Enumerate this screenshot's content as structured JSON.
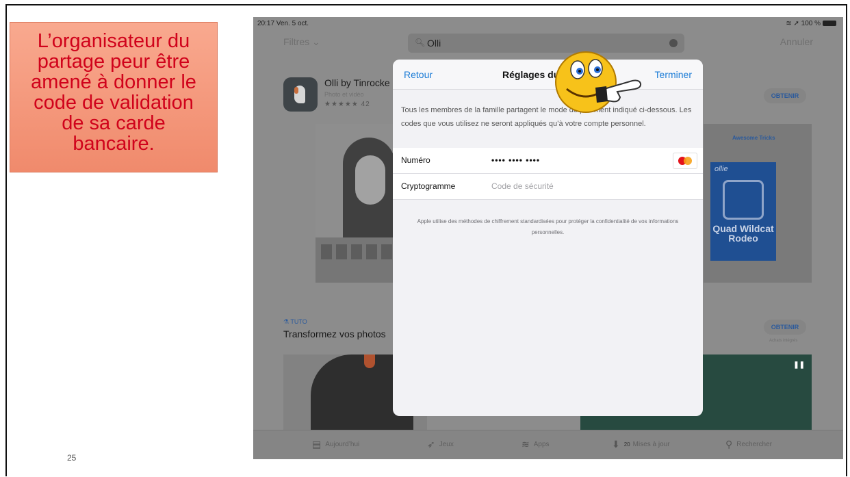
{
  "callout": {
    "lines": [
      "L’organisateur du",
      "partage peur être",
      "amené à donner le",
      "code de validation",
      "de sa carde",
      "bancaire."
    ]
  },
  "slide": {
    "page_number": "25"
  },
  "status_bar": {
    "time": "20:17  Ven. 5 oct.",
    "right": "100 %"
  },
  "top_bar": {
    "filters": "Filtres",
    "search_value": "Olli",
    "cancel": "Annuler"
  },
  "app": {
    "name": "Olli by Tinrocke",
    "category": "Photo et vidéo",
    "rating_count": "42",
    "get_label": "OBTENIR"
  },
  "right_panel": {
    "tag": "Awesome Tricks",
    "poster_logo": "ollie",
    "poster_title": "Quad Wildcat Rodeo"
  },
  "tuto": {
    "label": "TUTO",
    "title": "Transformez vos photos",
    "get_label": "OBTENIR",
    "sub": "Achats intégrés"
  },
  "modal": {
    "back": "Retour",
    "title": "Réglages du",
    "done": "Terminer",
    "info": "Tous les membres de la famille partagent le mode de paiement indiqué ci-dessous. Les codes que vous utilisez ne seront appliqués qu’à votre compte personnel.",
    "number_label": "Numéro",
    "number_value": "•••• •••• ••••",
    "cvv_label": "Cryptogramme",
    "cvv_placeholder": "Code de sécurité",
    "note": "Apple utilise des méthodes de chiffrement standardisées pour protéger la confidentialité de vos informations personnelles."
  },
  "tab_bar": [
    {
      "label": "Aujourd’hui",
      "icon": "today-icon"
    },
    {
      "label": "Jeux",
      "icon": "rocket-icon"
    },
    {
      "label": "Apps",
      "icon": "layers-icon"
    },
    {
      "label": "Mises à jour",
      "icon": "download-icon",
      "badge": "20"
    },
    {
      "label": "Rechercher",
      "icon": "search-icon"
    }
  ],
  "colors": {
    "callout_text": "#d0021b",
    "callout_bg": "#f4957a",
    "ios_blue": "#1a7bd6"
  }
}
